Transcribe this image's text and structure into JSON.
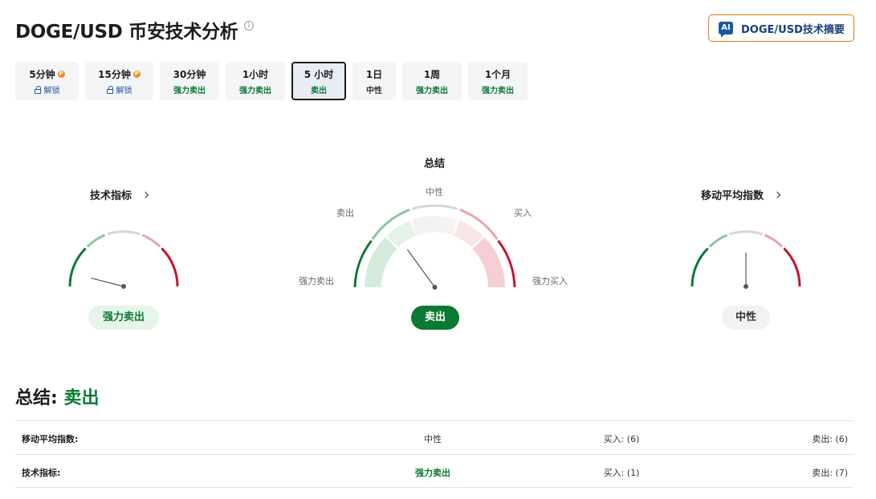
{
  "header": {
    "title": "DOGE/USD 币安技术分析",
    "ai_button_icon": "AI",
    "ai_button_label": "DOGE/USD技术摘要"
  },
  "tabs": [
    {
      "label": "5分钟",
      "sub": "解锁",
      "pro": true,
      "locked": true
    },
    {
      "label": "15分钟",
      "sub": "解锁",
      "pro": true,
      "locked": true
    },
    {
      "label": "30分钟",
      "sub": "强力卖出"
    },
    {
      "label": "1小时",
      "sub": "强力卖出"
    },
    {
      "label": "5 小时",
      "sub": "卖出",
      "active": true
    },
    {
      "label": "1日",
      "sub": "中性"
    },
    {
      "label": "1周",
      "sub": "强力卖出"
    },
    {
      "label": "1个月",
      "sub": "强力卖出"
    }
  ],
  "gauges": {
    "technical": {
      "title": "技术指标",
      "verdict": "强力卖出",
      "needle_level": 0.08
    },
    "summary": {
      "title": "总结",
      "verdict": "卖出",
      "needle_level": 0.3,
      "labels": {
        "strong_sell": "强力卖出",
        "sell": "卖出",
        "neutral": "中性",
        "buy": "买入",
        "strong_buy": "强力买入"
      }
    },
    "moving_averages": {
      "title": "移动平均指数",
      "verdict": "中性",
      "needle_level": 0.5
    }
  },
  "summary": {
    "heading_label": "总结:",
    "heading_value": "卖出",
    "rows": [
      {
        "name": "移动平均指数:",
        "verdict": "中性",
        "buy": "买入: (6)",
        "sell": "卖出: (6)"
      },
      {
        "name": "技术指标:",
        "verdict": "强力卖出",
        "buy": "买入: (1)",
        "sell": "卖出: (7)"
      }
    ]
  },
  "colors": {
    "green": "#0a7a32",
    "light_green": "#8fc29f",
    "red": "#c8102e",
    "light_red": "#eaa3a8",
    "neutral": "#d6d6d6",
    "accent_orange": "#e4790f",
    "brand_blue": "#1a56a8"
  },
  "icons": {
    "info": "info-icon",
    "ai": "ai-icon",
    "pro": "pro-badge-icon",
    "lock": "lock-icon",
    "chevron": "chevron-right-icon"
  }
}
